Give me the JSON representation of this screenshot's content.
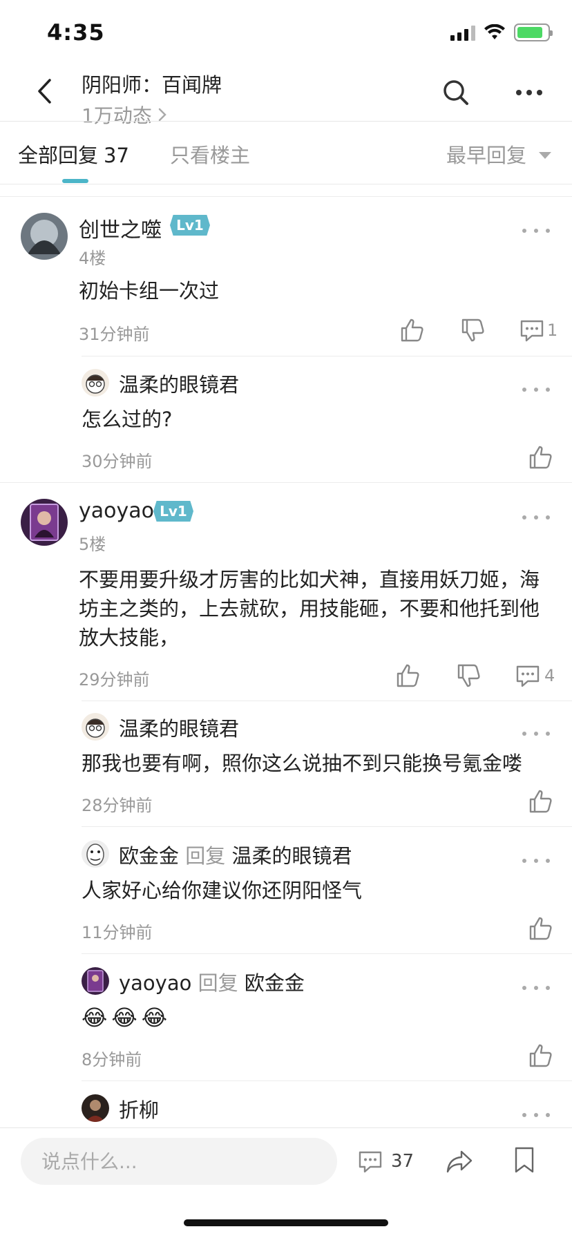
{
  "status_bar": {
    "time": "4:35"
  },
  "header": {
    "title": "阴阳师：百闻牌",
    "subtitle": "1万动态"
  },
  "tabs": {
    "all_label": "全部回复",
    "all_count": "37",
    "owner_only": "只看楼主",
    "sort": "最早回复"
  },
  "posts": [
    {
      "username": "创世之噬",
      "level": "Lv1",
      "floor": "4楼",
      "content": "初始卡组一次过",
      "time": "31分钟前",
      "reply_count": "1",
      "replies": [
        {
          "username": "温柔的眼镜君",
          "content": "怎么过的?",
          "time": "30分钟前"
        }
      ]
    },
    {
      "username": "yaoyao",
      "level": "Lv1",
      "floor": "5楼",
      "content": "不要用要升级才厉害的比如犬神，直接用妖刀姬，海坊主之类的，上去就砍，用技能砸，不要和他托到他放大技能，",
      "time": "29分钟前",
      "reply_count": "4",
      "replies": [
        {
          "username": "温柔的眼镜君",
          "content": "那我也要有啊，照你这么说抽不到只能换号氪金喽",
          "time": "28分钟前"
        },
        {
          "username": "欧金金",
          "reply_word": "回复",
          "reply_to": "温柔的眼镜君",
          "content": "人家好心给你建议你还阴阳怪气",
          "time": "11分钟前"
        },
        {
          "username": "yaoyao",
          "reply_word": "回复",
          "reply_to": "欧金金",
          "content": "😂😂😂",
          "time": "8分钟前"
        },
        {
          "username": "折柳"
        }
      ]
    }
  ],
  "bottom_bar": {
    "input_placeholder": "说点什么...",
    "comment_count": "37"
  },
  "colors": {
    "accent": "#4bb5c8",
    "level_badge": "#5fb8cb",
    "muted_text": "#999999"
  }
}
